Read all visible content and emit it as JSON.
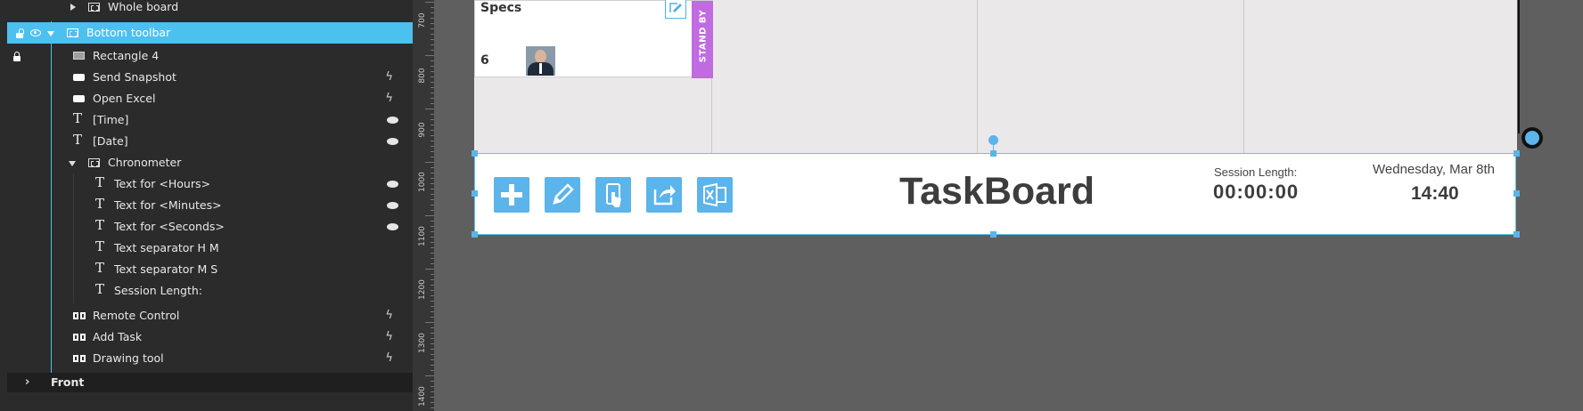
{
  "layers": {
    "whole_board": "Whole board",
    "bottom_toolbar": "Bottom toolbar",
    "rectangle4": "Rectangle 4",
    "send_snapshot": "Send Snapshot",
    "open_excel": "Open Excel",
    "time": "[Time]",
    "date": "[Date]",
    "chronometer": "Chronometer",
    "text_hours": "Text for <Hours>",
    "text_minutes": "Text for <Minutes>",
    "text_seconds": "Text for <Seconds>",
    "sep_hm": "Text separator H M",
    "sep_ms": "Text separator M S",
    "session_length": "Session Length:",
    "remote_control": "Remote Control",
    "add_task": "Add Task",
    "drawing_tool": "Drawing tool",
    "front": "Front"
  },
  "ruler": {
    "labels": [
      "700",
      "800",
      "900",
      "1000",
      "1100",
      "1200",
      "1300",
      "1400"
    ]
  },
  "card": {
    "title": "Specs",
    "count": "6",
    "tag": "STAND BY"
  },
  "toolbar": {
    "title": "TaskBoard",
    "session_label": "Session Length:",
    "session_value": "00:00:00",
    "date": "Wednesday, Mar 8th",
    "time": "14:40"
  },
  "colors": {
    "accent": "#4cc0ef",
    "button": "#5bb4ea",
    "tag": "#c06be0",
    "panel": "#2b2b2b"
  }
}
